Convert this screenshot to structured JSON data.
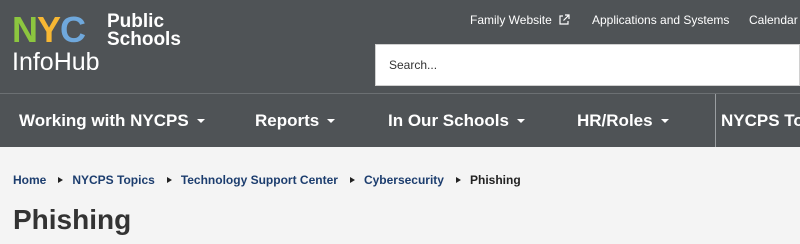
{
  "logo": {
    "nyc_letters": [
      "N",
      "Y",
      "C"
    ],
    "nyc_colors": [
      "#8cc63f",
      "#f7b733",
      "#6fa8dc"
    ],
    "public": "Public",
    "schools": "Schools",
    "infohub": "InfoHub"
  },
  "toplinks": {
    "family": "Family Website",
    "apps": "Applications and Systems",
    "calendar": "Calendar"
  },
  "search": {
    "placeholder": "Search..."
  },
  "nav": {
    "items": [
      {
        "label": "Working with NYCPS"
      },
      {
        "label": "Reports"
      },
      {
        "label": "In Our Schools"
      },
      {
        "label": "HR/Roles"
      },
      {
        "label": "NYCPS To"
      }
    ]
  },
  "breadcrumb": {
    "items": [
      "Home",
      "NYCPS Topics",
      "Technology Support Center",
      "Cybersecurity"
    ],
    "current": "Phishing"
  },
  "page": {
    "title": "Phishing"
  },
  "colors": {
    "header_bg": "#4f5356",
    "link": "#1c3d6e",
    "page_bg": "#f4f4f4"
  }
}
